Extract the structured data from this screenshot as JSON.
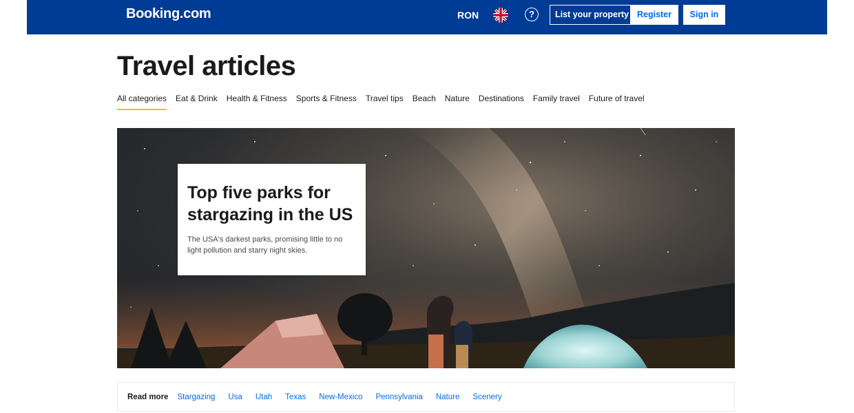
{
  "header": {
    "logo": "Booking.com",
    "currency": "RON",
    "help_symbol": "?",
    "list_property_label": "List your property",
    "register_label": "Register",
    "signin_label": "Sign in"
  },
  "page": {
    "title": "Travel articles"
  },
  "tabs": [
    {
      "label": "All categories",
      "active": true
    },
    {
      "label": "Eat & Drink"
    },
    {
      "label": "Health & Fitness"
    },
    {
      "label": "Sports & Fitness"
    },
    {
      "label": "Travel tips"
    },
    {
      "label": "Beach"
    },
    {
      "label": "Nature"
    },
    {
      "label": "Destinations"
    },
    {
      "label": "Family travel"
    },
    {
      "label": "Future of travel"
    }
  ],
  "hero": {
    "title": "Top five parks for stargazing in the US",
    "description": "The USA's darkest parks, promising little to no light pollution and starry night skies."
  },
  "read_more": {
    "label": "Read more",
    "tags": [
      "Stargazing",
      "Usa",
      "Utah",
      "Texas",
      "New-Mexico",
      "Pennsylvania",
      "Nature",
      "Scenery"
    ]
  },
  "colors": {
    "brand_blue": "#003b95",
    "link_blue": "#006ce4",
    "tab_underline": "#febb02"
  },
  "icons": [
    "uk-flag-icon",
    "help-icon"
  ]
}
